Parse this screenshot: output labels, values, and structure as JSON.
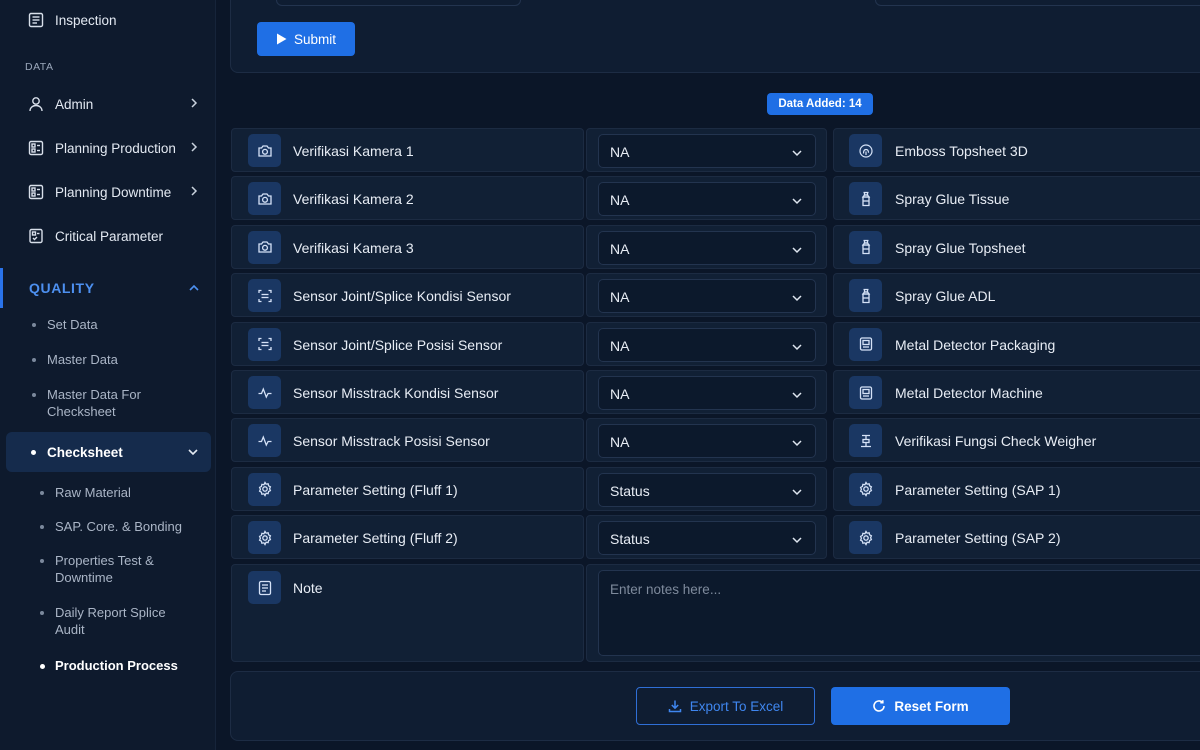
{
  "colors": {
    "accent": "#1f6fe5",
    "background": "#0b1628",
    "sidebar": "#0e1a2d",
    "icon_box": "#1a3763"
  },
  "sidebar": {
    "inspection": "Inspection",
    "data_section": "DATA",
    "admin": "Admin",
    "planning_production": "Planning Production",
    "planning_downtime": "Planning Downtime",
    "critical_parameter": "Critical Parameter",
    "quality": "QUALITY",
    "set_data": "Set Data",
    "master_data": "Master Data",
    "master_data_checksheet_1": "Master Data For",
    "master_data_checksheet_2": "Checksheet",
    "checksheet": "Checksheet",
    "raw_material": "Raw Material",
    "sap_core": "SAP. Core. & Bonding",
    "properties_1": "Properties Test &",
    "properties_2": "Downtime",
    "daily_1": "Daily Report Splice",
    "daily_2": "Audit",
    "production_process": "Production Process"
  },
  "form": {
    "submit_label": "Submit",
    "badge": "Data Added: 14",
    "rows": [
      {
        "label": "Verifikasi Kamera 1",
        "icon": "camera-icon",
        "value": "NA",
        "right": "Emboss Topsheet 3D",
        "right_icon": "fingerprint-icon"
      },
      {
        "label": "Verifikasi Kamera 2",
        "icon": "camera-icon",
        "value": "NA",
        "right": "Spray Glue Tissue",
        "right_icon": "spray-bottle-icon"
      },
      {
        "label": "Verifikasi Kamera 3",
        "icon": "camera-icon",
        "value": "NA",
        "right": "Spray Glue Topsheet",
        "right_icon": "spray-bottle-icon"
      },
      {
        "label": "Sensor Joint/Splice Kondisi Sensor",
        "icon": "scan-icon",
        "value": "NA",
        "right": "Spray Glue ADL",
        "right_icon": "spray-bottle-icon"
      },
      {
        "label": "Sensor Joint/Splice Posisi Sensor",
        "icon": "scan-icon",
        "value": "NA",
        "right": "Metal Detector Packaging",
        "right_icon": "detector-icon"
      },
      {
        "label": "Sensor Misstrack Kondisi Sensor",
        "icon": "activity-icon",
        "value": "NA",
        "right": "Metal Detector Machine",
        "right_icon": "detector-icon"
      },
      {
        "label": "Sensor Misstrack Posisi Sensor",
        "icon": "activity-icon",
        "value": "NA",
        "right": "Verifikasi Fungsi Check Weigher",
        "right_icon": "scale-icon"
      },
      {
        "label": "Parameter Setting (Fluff 1)",
        "icon": "gear-icon",
        "value": "Status",
        "right": "Parameter Setting (SAP 1)",
        "right_icon": "gear-icon"
      },
      {
        "label": "Parameter Setting (Fluff 2)",
        "icon": "gear-icon",
        "value": "Status",
        "right": "Parameter Setting (SAP 2)",
        "right_icon": "gear-icon"
      }
    ],
    "note_label": "Note",
    "note_placeholder": "Enter notes here...",
    "export_label": "Export To Excel",
    "reset_label": "Reset Form"
  }
}
